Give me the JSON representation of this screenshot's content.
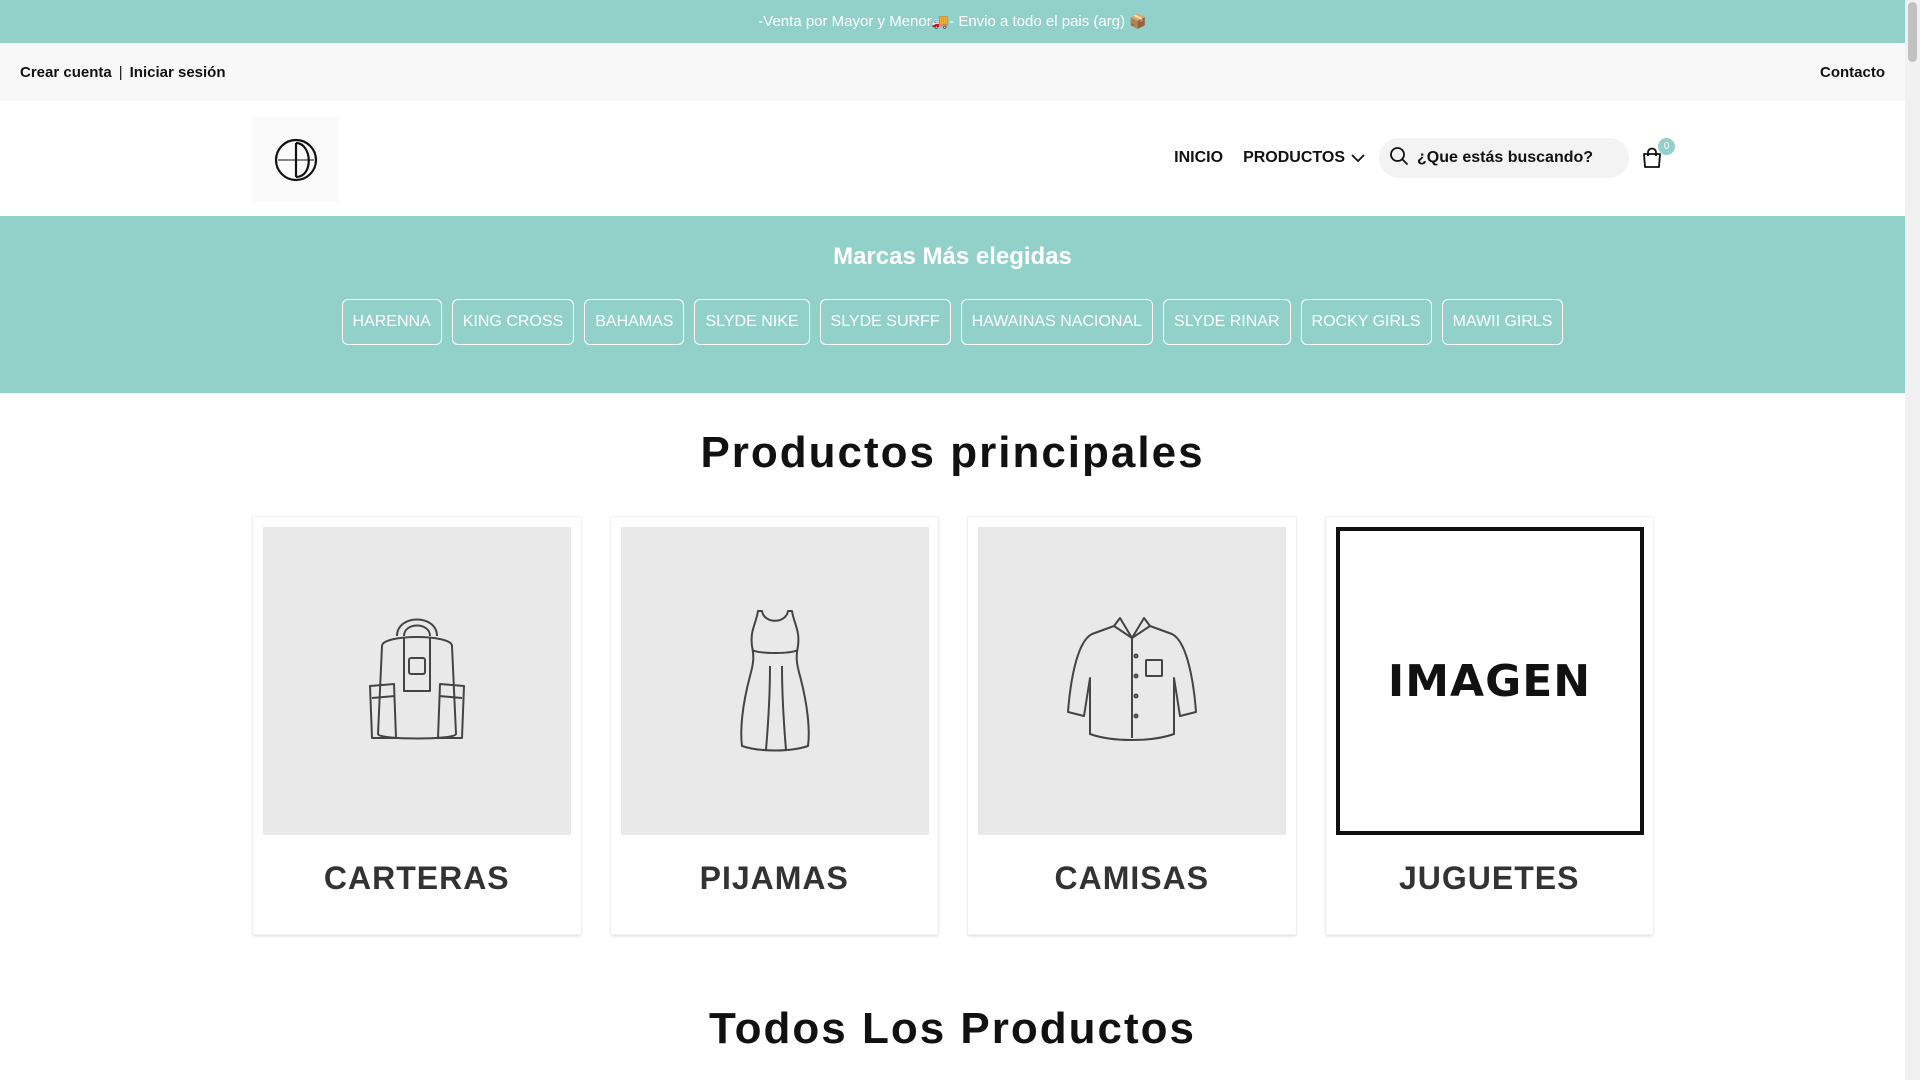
{
  "topbar": {
    "text_before": "-Venta por Mayor y Menor",
    "truck_emoji": "🚚",
    "text_middle": "- Envio a todo el pais (arg) ",
    "box_emoji": "📦"
  },
  "account": {
    "create_account": "Crear cuenta",
    "separator": "|",
    "login": "Iniciar sesión",
    "contact": "Contacto"
  },
  "nav": {
    "inicio": "INICIO",
    "productos": "PRODUCTOS",
    "search_placeholder": "¿Que estás buscando?",
    "cart_count": "0"
  },
  "brands": {
    "title": "Marcas Más elegidas",
    "items": [
      "HARENNA",
      "KING CROSS",
      "BAHAMAS",
      "SLYDE NIKE",
      "SLYDE SURFF",
      "HAWAINAS NACIONAL",
      "SLYDE RINAR",
      "ROCKY GIRLS",
      "MAWII GIRLS"
    ]
  },
  "main_products": {
    "title": "Productos principales",
    "cards": [
      {
        "label": "CARTERAS",
        "icon": "backpack-icon"
      },
      {
        "label": "PIJAMAS",
        "icon": "dress-icon"
      },
      {
        "label": "CAMISAS",
        "icon": "shirt-icon"
      },
      {
        "label": "JUGUETES",
        "image_text": "IMAGEN"
      }
    ]
  },
  "all_products": {
    "title": "Todos Los Productos"
  },
  "colors": {
    "accent": "#92d1ca",
    "placeholder_bg": "#e9e9e9"
  }
}
